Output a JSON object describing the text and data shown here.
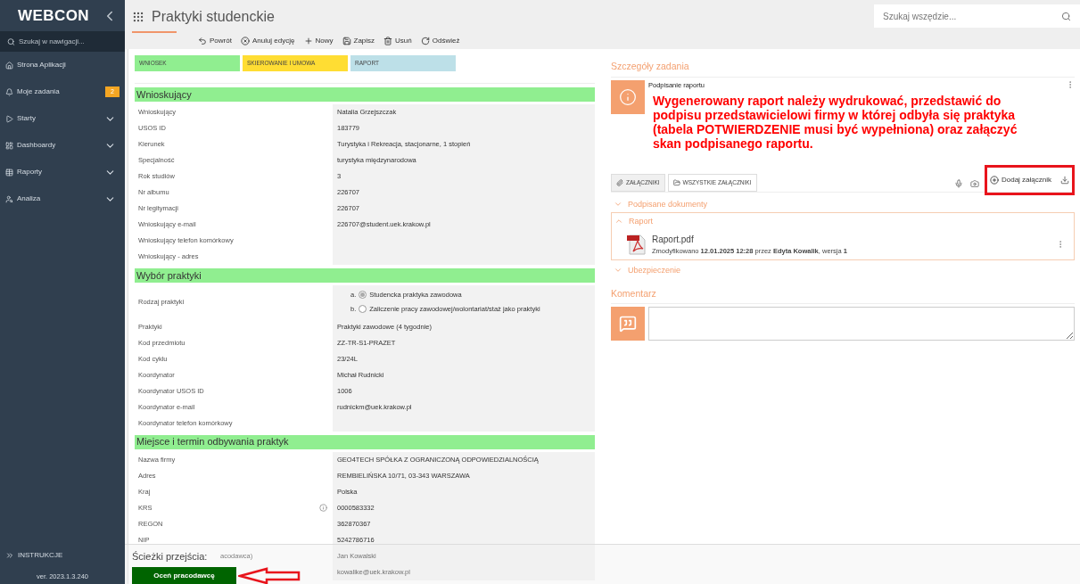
{
  "sidebar": {
    "logo": "WEBCON",
    "search_placeholder": "Szukaj w nawigacji...",
    "items": [
      {
        "kind": "home",
        "label": "Strona Aplikacji",
        "expandable": false
      },
      {
        "kind": "bell",
        "label": "Moje zadania",
        "badge": "2",
        "expandable": false
      },
      {
        "kind": "play",
        "label": "Starty",
        "expandable": true
      },
      {
        "kind": "dashboard",
        "label": "Dashboardy",
        "expandable": true
      },
      {
        "kind": "table",
        "label": "Raporty",
        "expandable": true
      },
      {
        "kind": "user",
        "label": "Analiza",
        "expandable": true
      }
    ],
    "footer_link": "INSTRUKCJE",
    "version": "ver. 2023.1.3.240"
  },
  "header": {
    "title": "Praktyki studenckie",
    "search_placeholder": "Szukaj wszędzie...",
    "toolbar": [
      {
        "kind": "back",
        "label": "Powrót"
      },
      {
        "kind": "cancel",
        "label": "Anuluj edycję"
      },
      {
        "kind": "new",
        "label": "Nowy"
      },
      {
        "kind": "save",
        "label": "Zapisz"
      },
      {
        "kind": "delete",
        "label": "Usuń"
      },
      {
        "kind": "refresh",
        "label": "Odśwież"
      }
    ]
  },
  "form_tabs": [
    {
      "label": "WNIOSEK",
      "color": "#90ee90"
    },
    {
      "label": "SKIEROWANIE I UMOWA",
      "color": "#ffdd33"
    },
    {
      "label": "RAPORT",
      "color": "#bde0e8"
    }
  ],
  "sections": [
    {
      "title": "Wnioskujący",
      "rows": [
        {
          "kind": "text",
          "label": "Wnioskujący",
          "value": "Natalia Grzejszczak"
        },
        {
          "kind": "text",
          "label": "USOS ID",
          "value": "183779"
        },
        {
          "kind": "text",
          "label": "Kierunek",
          "value": "Turystyka i Rekreacja, stacjonarne, 1 stopień"
        },
        {
          "kind": "text",
          "label": "Specjalność",
          "value": "turystyka międzynarodowa"
        },
        {
          "kind": "text",
          "label": "Rok studiów",
          "value": "3"
        },
        {
          "kind": "text",
          "label": "Nr albumu",
          "value": "226707"
        },
        {
          "kind": "text",
          "label": "Nr legitymacji",
          "value": "226707"
        },
        {
          "kind": "text",
          "label": "Wnioskujący e-mail",
          "value": "226707@student.uek.krakow.pl"
        },
        {
          "kind": "text",
          "label": "Wnioskujący telefon komórkowy"
        },
        {
          "kind": "text",
          "label": "Wnioskujący - adres"
        }
      ]
    },
    {
      "title": "Wybór praktyki",
      "rows": [
        {
          "kind": "radio",
          "label": "Rodzaj praktyki",
          "options": [
            {
              "marker": "a.",
              "label": "Studencka praktyka zawodowa",
              "selected": true
            },
            {
              "marker": "b.",
              "label": "Zaliczenie pracy zawodowej/wolontariat/staż jako praktyki",
              "selected": false
            }
          ]
        },
        {
          "kind": "text",
          "label": "Praktyki",
          "value": "Praktyki zawodowe (4 tygodnie)"
        },
        {
          "kind": "text",
          "label": "Kod przedmiotu",
          "value": "ZZ-TR-S1-PRAZET"
        },
        {
          "kind": "text",
          "label": "Kod cyklu",
          "value": "23/24L"
        },
        {
          "kind": "text",
          "label": "Koordynator",
          "value": "Michał Rudnicki"
        },
        {
          "kind": "text",
          "label": "Koordynator USOS ID",
          "value": "1006"
        },
        {
          "kind": "text",
          "label": "Koordynator e-mail",
          "value": "rudnickm@uek.krakow.pl"
        },
        {
          "kind": "text",
          "label": "Koordynator telefon komórkowy"
        }
      ]
    },
    {
      "title": "Miejsce i termin odbywania praktyk",
      "rows": [
        {
          "kind": "text",
          "label": "Nazwa firmy",
          "value": "GEO4TECH SPÓŁKA Z OGRANICZONĄ ODPOWIEDZIALNOŚCIĄ"
        },
        {
          "kind": "text",
          "label": "Adres",
          "value": "REMBIELIŃSKA 10/71, 03-343 WARSZAWA"
        },
        {
          "kind": "text",
          "label": "Kraj",
          "value": "Polska"
        },
        {
          "kind": "text",
          "label": "KRS",
          "value": "0000583332",
          "info": true
        },
        {
          "kind": "text",
          "label": "REGON",
          "value": "362870367"
        },
        {
          "kind": "text",
          "label": "NIP",
          "value": "5242786716"
        },
        {
          "kind": "covered",
          "label": "acodawca)",
          "value": "Jan Kowalski"
        },
        {
          "kind": "covered",
          "value": "kowalike@uek.krakow.pl"
        }
      ]
    }
  ],
  "task": {
    "heading": "Szczegóły zadania",
    "title": "Podpisanie raportu",
    "message": "Wygenerowany raport należy wydrukować, przedstawić do podpisu przedstawicielowi firmy w której odbyła się praktyka (tabela POTWIERDZENIE musi być wypełniona) oraz załączyć skan podpisanego raportu."
  },
  "attachments": {
    "tabs": [
      {
        "kind": "clip",
        "label": "ZAŁĄCZNIKI",
        "selected": true
      },
      {
        "kind": "folder",
        "label": "WSZYSTKIE ZAŁĄCZNIKI",
        "selected": false
      }
    ],
    "add_label": "Dodaj załącznik",
    "groups": [
      {
        "title": "Podpisane dokumenty",
        "expanded": false
      },
      {
        "title": "Raport",
        "expanded": true,
        "files": [
          {
            "name": "Raport.pdf",
            "meta": "Zmodyfikowano **12.01.2025 12:28** przez **Edyta Kowalik**, wersja **1**"
          }
        ]
      },
      {
        "title": "Ubezpieczenie",
        "expanded": false
      }
    ]
  },
  "comment": {
    "heading": "Komentarz"
  },
  "transitions": {
    "heading": "Ścieżki przejścia:",
    "buttons": [
      "Oceń pracodawcę"
    ]
  }
}
